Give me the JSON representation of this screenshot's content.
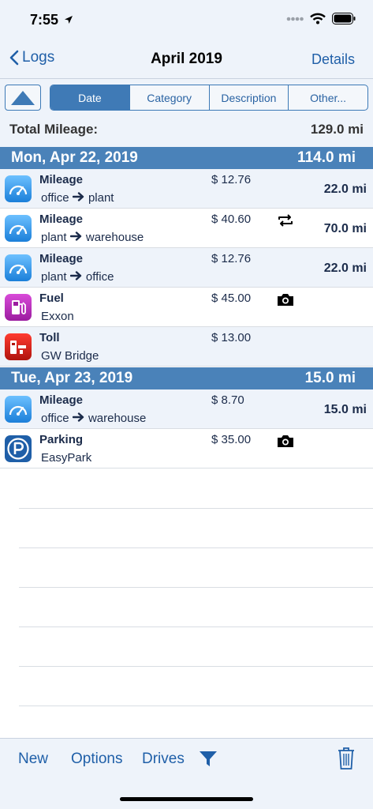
{
  "status": {
    "time": "7:55"
  },
  "nav": {
    "back_label": "Logs",
    "title": "April 2019",
    "details_label": "Details"
  },
  "segments": {
    "items": [
      "Date",
      "Category",
      "Description",
      "Other..."
    ],
    "active": "Date"
  },
  "total": {
    "label": "Total Mileage:",
    "value": "129.0 mi"
  },
  "days": [
    {
      "date": "Mon, Apr 22, 2019",
      "total": "114.0 mi",
      "entries": [
        {
          "icon": "mileage-icon",
          "type": "Mileage",
          "from": "office",
          "to": "plant",
          "amount": "$ 12.76",
          "extra": "",
          "distance": "22.0 mi"
        },
        {
          "icon": "mileage-icon",
          "type": "Mileage",
          "from": "plant",
          "to": "warehouse",
          "amount": "$ 40.60",
          "extra": "round-trip-icon",
          "distance": "70.0 mi"
        },
        {
          "icon": "mileage-icon",
          "type": "Mileage",
          "from": "plant",
          "to": "office",
          "amount": "$ 12.76",
          "extra": "",
          "distance": "22.0 mi"
        },
        {
          "icon": "fuel-icon",
          "type": "Fuel",
          "description": "Exxon",
          "amount": "$ 45.00",
          "extra": "camera-icon",
          "distance": ""
        },
        {
          "icon": "toll-icon",
          "type": "Toll",
          "description": "GW Bridge",
          "amount": "$ 13.00",
          "extra": "",
          "distance": ""
        }
      ]
    },
    {
      "date": "Tue, Apr 23, 2019",
      "total": "15.0 mi",
      "entries": [
        {
          "icon": "mileage-icon",
          "type": "Mileage",
          "from": "office",
          "to": "warehouse",
          "amount": "$ 8.70",
          "extra": "",
          "distance": "15.0 mi"
        },
        {
          "icon": "parking-icon",
          "type": "Parking",
          "description": "EasyPark",
          "amount": "$ 35.00",
          "extra": "camera-icon",
          "distance": ""
        }
      ]
    }
  ],
  "toolbar": {
    "new_label": "New",
    "options_label": "Options",
    "drives_label": "Drives"
  },
  "colors": {
    "accent": "#1f5fa8",
    "header_bg": "#4a82b9",
    "row_shade": "#eef3fa"
  }
}
